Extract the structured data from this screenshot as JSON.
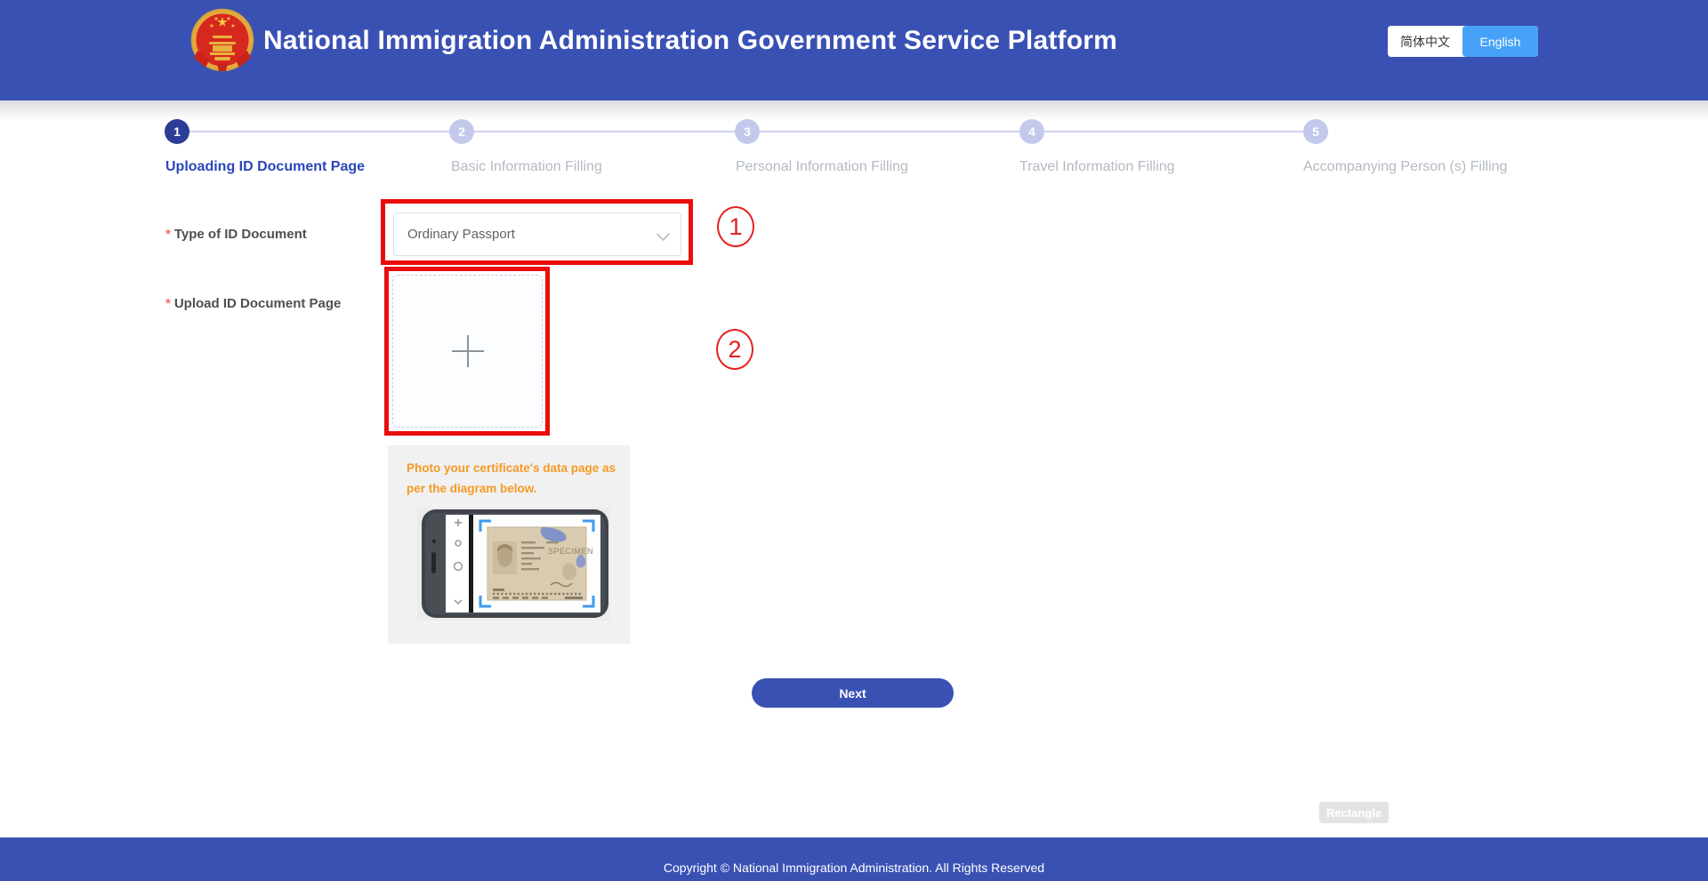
{
  "header": {
    "title": "National Immigration Administration Government Service Platform",
    "lang_zh": "简体中文",
    "lang_en": "English"
  },
  "steps": {
    "items": [
      {
        "num": "1",
        "label": "Uploading ID Document Page",
        "state": "active"
      },
      {
        "num": "2",
        "label": "Basic Information Filling",
        "state": "inactive"
      },
      {
        "num": "3",
        "label": "Personal Information Filling",
        "state": "inactive"
      },
      {
        "num": "4",
        "label": "Travel Information Filling",
        "state": "inactive"
      },
      {
        "num": "5",
        "label": "Accompanying Person (s) Filling",
        "state": "inactive"
      }
    ]
  },
  "form": {
    "required_mark": "*",
    "type_label": "Type of ID Document",
    "type_value": "Ordinary Passport",
    "upload_label": "Upload ID Document Page"
  },
  "annotations": {
    "n1": "1",
    "n2": "2"
  },
  "instruction": {
    "text": "Photo your certificate's data page as per the diagram below.",
    "specimen": "SPECIMEN"
  },
  "actions": {
    "next_label": "Next"
  },
  "overlay": {
    "rectangle_label": "Rectangle"
  },
  "footer": {
    "copyright": "Copyright © National Immigration Administration. All Rights Reserved"
  },
  "icons": {
    "logo": "national-emblem",
    "select": "chevron-down",
    "upload": "plus"
  },
  "colors": {
    "header_blue": "#3a51b4",
    "active_step_blue": "#2c3d96",
    "step_label_blue": "#2b46bb",
    "inactive_gray": "#b4bac3",
    "lang_button_blue": "#46a1f8",
    "annotation_red": "#ea0d0d",
    "hint_orange": "#f59a23",
    "required_red": "#f56c6c"
  }
}
